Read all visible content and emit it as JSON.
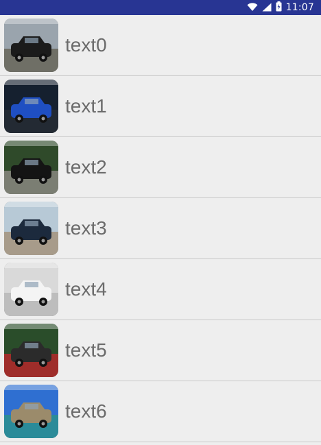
{
  "status_bar": {
    "time": "11:07",
    "icons": [
      "wifi-icon",
      "signal-icon",
      "battery-icon"
    ],
    "background": "#283593"
  },
  "list": {
    "items": [
      {
        "label": "text0",
        "thumbnail": "black-suv-photo",
        "colors": {
          "sky": "#9aa4ad",
          "ground": "#6f6f66",
          "car": "#1b1b1b"
        }
      },
      {
        "label": "text1",
        "thumbnail": "blue-sports-car-photo",
        "colors": {
          "sky": "#15202f",
          "ground": "#232a33",
          "car": "#1f4fc2"
        }
      },
      {
        "label": "text2",
        "thumbnail": "black-sedan-photo",
        "colors": {
          "sky": "#2f4a2a",
          "ground": "#7b7e73",
          "car": "#141414"
        }
      },
      {
        "label": "text3",
        "thumbnail": "people-and-car-photo",
        "colors": {
          "sky": "#b7c9d6",
          "ground": "#a79b8a",
          "car": "#1c2a3d"
        }
      },
      {
        "label": "text4",
        "thumbnail": "white-suv-photo",
        "colors": {
          "sky": "#d9d9d9",
          "ground": "#bdbdbd",
          "car": "#f4f4f4"
        }
      },
      {
        "label": "text5",
        "thumbnail": "car-on-red-carpet-photo",
        "colors": {
          "sky": "#2a4d2a",
          "ground": "#9f2d2a",
          "car": "#2b2b2b"
        }
      },
      {
        "label": "text6",
        "thumbnail": "lake-landscape-photo",
        "colors": {
          "sky": "#2f6fd1",
          "ground": "#2b8b99",
          "car": "#9b8b6b"
        }
      }
    ]
  }
}
